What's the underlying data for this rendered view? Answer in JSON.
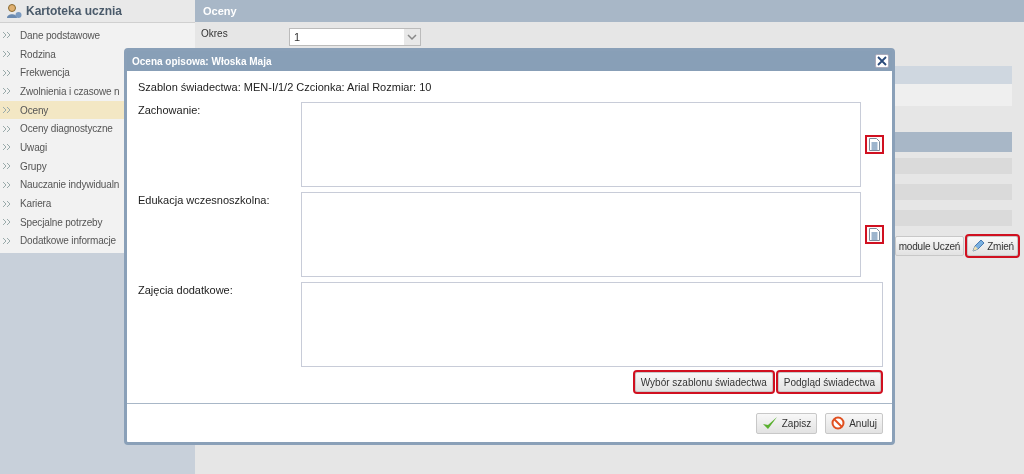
{
  "sidebar": {
    "title": "Kartoteka ucznia",
    "items": [
      {
        "label": "Dane podstawowe",
        "selected": false
      },
      {
        "label": "Rodzina",
        "selected": false
      },
      {
        "label": "Frekwencja",
        "selected": false
      },
      {
        "label": "Zwolnienia i czasowe n",
        "selected": false
      },
      {
        "label": "Oceny",
        "selected": true
      },
      {
        "label": "Oceny diagnostyczne",
        "selected": false
      },
      {
        "label": "Uwagi",
        "selected": false
      },
      {
        "label": "Grupy",
        "selected": false
      },
      {
        "label": "Nauczanie indywidualn",
        "selected": false
      },
      {
        "label": "Kariera",
        "selected": false
      },
      {
        "label": "Specjalne potrzeby",
        "selected": false
      },
      {
        "label": "Dodatkowe informacje",
        "selected": false
      }
    ]
  },
  "main": {
    "title": "Oceny",
    "period_label": "Okres",
    "period_value": "1",
    "buttons": [
      {
        "label": "module Uczeń",
        "kind": "plain",
        "highlighted": false
      },
      {
        "label": "Zmień",
        "kind": "edit",
        "highlighted": true
      }
    ]
  },
  "dialog": {
    "title": "Ocena opisowa: Włoska Maja",
    "info": "Szablon świadectwa: MEN-I/1/2 Czcionka: Arial Rozmiar: 10",
    "fields": [
      {
        "label": "Zachowanie:",
        "template_button": true,
        "highlighted": true
      },
      {
        "label": "Edukacja wczesnoszkolna:",
        "template_button": true,
        "highlighted": true
      },
      {
        "label": "Zajęcia dodatkowe:",
        "template_button": false
      }
    ],
    "buttons": [
      {
        "label": "Wybór szablonu świadectwa",
        "highlighted": true
      },
      {
        "label": "Podgląd świadectwa",
        "highlighted": true
      }
    ],
    "footer_buttons": [
      {
        "label": "Zapisz",
        "kind": "save"
      },
      {
        "label": "Anuluj",
        "kind": "cancel"
      }
    ]
  }
}
